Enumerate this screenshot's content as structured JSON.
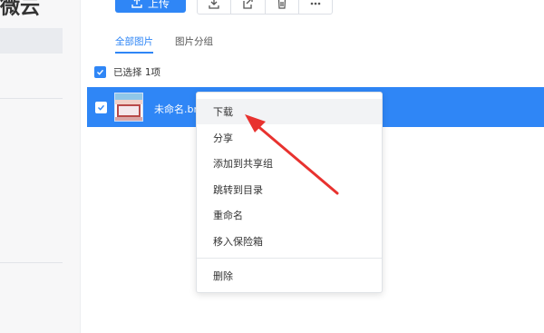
{
  "app": {
    "logo_text": "微云"
  },
  "toolbar": {
    "upload_label": "上传"
  },
  "tabs": [
    {
      "label": "全部图片"
    },
    {
      "label": "图片分组"
    }
  ],
  "selection": {
    "text": "已选择 1项"
  },
  "file": {
    "name": "未命名.br"
  },
  "context_menu": {
    "items": [
      {
        "label": "下载"
      },
      {
        "label": "分享"
      },
      {
        "label": "添加到共享组"
      },
      {
        "label": "跳转到目录"
      },
      {
        "label": "重命名"
      },
      {
        "label": "移入保险箱"
      },
      {
        "label": "删除"
      }
    ]
  },
  "colors": {
    "accent": "#2f86f6",
    "annotation_arrow": "#e8322f"
  }
}
